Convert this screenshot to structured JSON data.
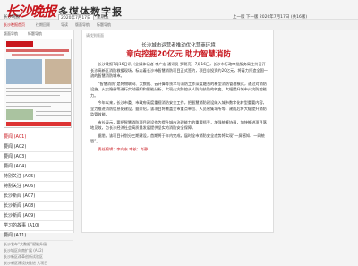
{
  "header": {
    "logo_text": "长沙晚报",
    "site_title": "多媒体数字报"
  },
  "toolbar": {
    "items": [
      "长沙晚报首页",
      "往期回顾",
      "导读",
      "版面导航",
      "标题导航"
    ]
  },
  "daterow": {
    "label": "长沙晚报",
    "date": "2020年7月17日",
    "weekday": "星期五",
    "lunar": "农历庚子年五月廿七",
    "right_text": "上一版  下一版  2020年7月17日 (共16版)"
  },
  "left": {
    "tabs": [
      "版面导航",
      "标题导航"
    ],
    "pages": [
      {
        "label": "要闻 (A01)",
        "active": true
      },
      {
        "label": "要闻 (A02)",
        "active": false
      },
      {
        "label": "要闻 (A03)",
        "active": false
      },
      {
        "label": "要闻 (A04)",
        "active": false
      },
      {
        "label": "特别关注 (A05)",
        "active": false
      },
      {
        "label": "特别关注 (A06)",
        "active": false
      },
      {
        "label": "长沙新闻 (A07)",
        "active": false
      },
      {
        "label": "长沙新闻 (A08)",
        "active": false
      },
      {
        "label": "长沙新闻 (A09)",
        "active": false
      },
      {
        "label": "学习的故事 (A10)",
        "active": false
      },
      {
        "label": "要闻 (A11)",
        "active": false
      }
    ],
    "subitems": [
      "长沙发布“大数据”赋能升级",
      "长沙城区向南扩展 (A12)",
      "长沙新区改革创新试验区",
      "长沙新区建设快推进 大项目"
    ]
  },
  "article": {
    "hint": "请找到版面",
    "kicker": "长沙城市运营者推动优化营商环境",
    "headline": "章向挖掘20亿元 助力智慧消防",
    "paragraphs": [
      "长沙晚报7月16日讯（全媒体记者 李广宏 通讯员 罗朝亮）7月16日，长沙市行政审批服务局主持召开长沙高新区消防救援现场，标志着长沙市智慧消防项目正式签约，项目总投资约20亿元，将着力打造全国一流的智慧消防城市。",
      "“智慧消防”是将物联网、大数据、云计算等技术与消防工作深度融合的新型消防管理模式，通过对消防设施、火灾隐患等进行实时感知和智能分析，实现火灾防控从人防向技防的转变，大幅提升城市火灾防控能力。",
      "今年以来，长沙市委、市政府高度重视消防安全工作，把智慧消防建设纳入城市数字化转型重要内容，全力推进消防信息化建设。据介绍，该项目将覆盖全市重点单位、人员密集场所等，建成后将大幅提升消防监管效能。",
      "市长表示，要把智慧消防项目建设作为提升城市治理能力的重要抓手，加强统筹协调，加快推进项目落地见效，为长沙经济社会高质量发展提供坚实的消防安全保障。",
      "据悉，该项目计划分三期建设，首期将于年内完成，届时全市消防安全态势将实现“一屏感知、一网统管”。",
      "责任编辑：李向东 审核：肖静"
    ]
  }
}
